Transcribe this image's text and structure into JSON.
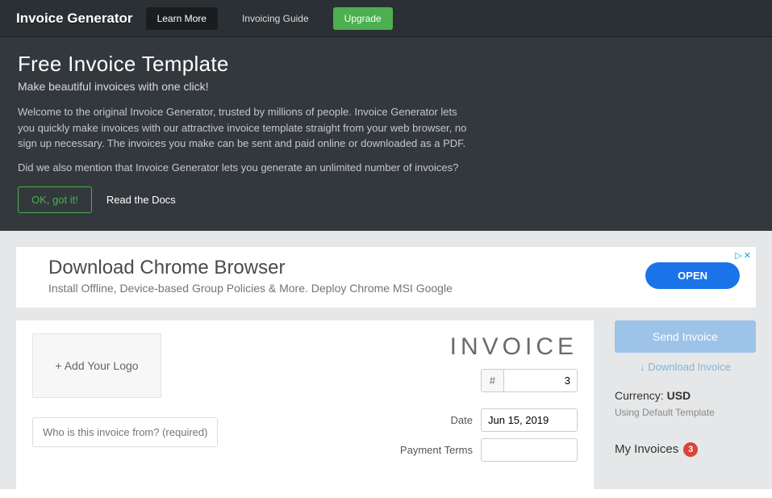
{
  "nav": {
    "brand": "Invoice Generator",
    "learn_more": "Learn More",
    "invoicing_guide": "Invoicing Guide",
    "upgrade": "Upgrade"
  },
  "hero": {
    "title": "Free Invoice Template",
    "subtitle": "Make beautiful invoices with one click!",
    "desc": "Welcome to the original Invoice Generator, trusted by millions of people. Invoice Generator lets you quickly make invoices with our attractive invoice template straight from your web browser, no sign up necessary. The invoices you make can be sent and paid online or downloaded as a PDF.",
    "mention": "Did we also mention that Invoice Generator lets you generate an unlimited number of invoices?",
    "ok": "OK, got it!",
    "docs": "Read the Docs"
  },
  "ad": {
    "title": "Download Chrome Browser",
    "sub": "Install Offline, Device-based Group Policies & More. Deploy Chrome MSI Google",
    "open": "OPEN",
    "chevron": "▷",
    "close": "✕"
  },
  "invoice": {
    "logo_label": "+ Add Your Logo",
    "title": "INVOICE",
    "hash": "#",
    "number": "3",
    "from_placeholder": "Who is this invoice from? (required)",
    "date_label": "Date",
    "date_value": "Jun 15, 2019",
    "payment_terms_label": "Payment Terms",
    "payment_terms_value": ""
  },
  "sidebar": {
    "send": "Send Invoice",
    "download": "↓ Download Invoice",
    "currency_label": "Currency:",
    "currency_value": "USD",
    "template": "Using Default Template",
    "my_invoices": "My Invoices",
    "count": "3"
  }
}
